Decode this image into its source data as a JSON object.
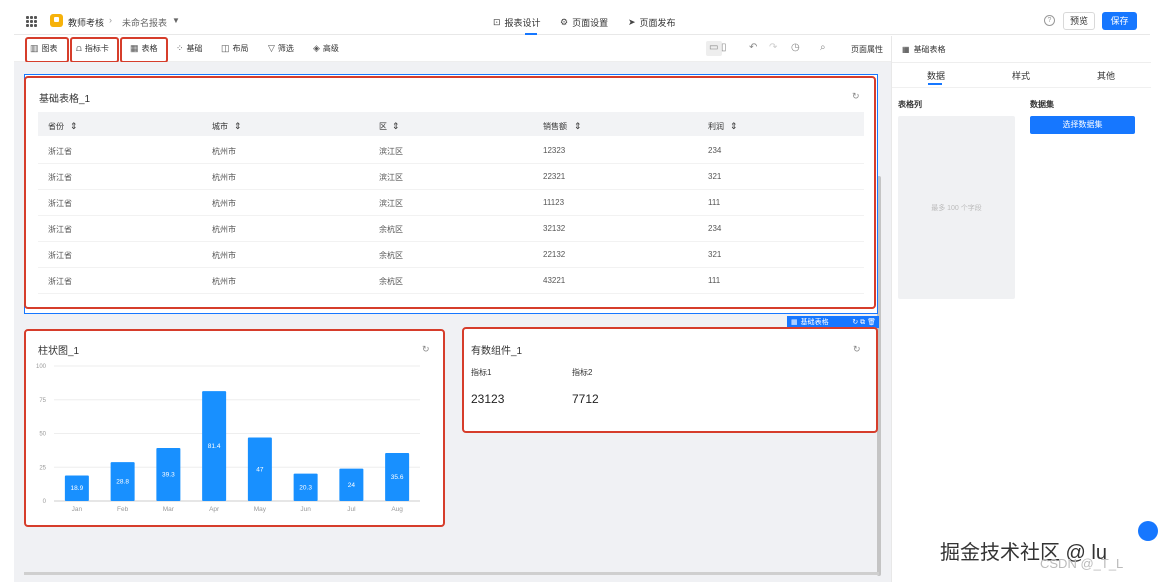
{
  "topbar": {
    "app_name": "教师考核",
    "report_name": "未命名报表",
    "nav": [
      {
        "icon": "report-design-icon",
        "label": "报表设计"
      },
      {
        "icon": "gear-icon",
        "label": "页面设置"
      },
      {
        "icon": "send-icon",
        "label": "页面发布"
      }
    ],
    "preview_label": "预览",
    "save_label": "保存"
  },
  "toolbar": {
    "tools": [
      {
        "icon": "bar-chart-icon",
        "label": "图表"
      },
      {
        "icon": "indicator-card-icon",
        "label": "指标卡"
      },
      {
        "icon": "table-icon",
        "label": "表格"
      },
      {
        "icon": "basic-icon",
        "label": "基础"
      },
      {
        "icon": "layout-icon",
        "label": "布局"
      },
      {
        "icon": "filter-icon",
        "label": "筛选"
      },
      {
        "icon": "advanced-icon",
        "label": "高级"
      }
    ],
    "page_props_label": "页面属性"
  },
  "right_panel": {
    "title": "基础表格",
    "tabs": [
      "数据",
      "样式",
      "其他"
    ],
    "active_tab": "数据",
    "columns_label": "表格列",
    "dataset_label": "数据集",
    "columns_hint": "最多 100 个字段",
    "select_dataset_label": "选择数据集"
  },
  "table_card": {
    "title": "基础表格_1",
    "headers": [
      "省份",
      "城市",
      "区",
      "销售额",
      "利润"
    ],
    "rows": [
      [
        "浙江省",
        "杭州市",
        "滨江区",
        "12323",
        "234"
      ],
      [
        "浙江省",
        "杭州市",
        "滨江区",
        "22321",
        "321"
      ],
      [
        "浙江省",
        "杭州市",
        "滨江区",
        "11123",
        "111"
      ],
      [
        "浙江省",
        "杭州市",
        "余杭区",
        "32132",
        "234"
      ],
      [
        "浙江省",
        "杭州市",
        "余杭区",
        "22132",
        "321"
      ],
      [
        "浙江省",
        "杭州市",
        "余杭区",
        "43221",
        "111"
      ]
    ],
    "selection_tag": "基础表格"
  },
  "bar_card": {
    "title": "柱状图_1"
  },
  "metric_card": {
    "title": "有数组件_1",
    "metrics": [
      {
        "label": "指标1",
        "value": "23123"
      },
      {
        "label": "指标2",
        "value": "7712"
      }
    ]
  },
  "chart_data": {
    "type": "bar",
    "categories": [
      "Jan",
      "Feb",
      "Mar",
      "Apr",
      "May",
      "Jun",
      "Jul",
      "Aug"
    ],
    "values": [
      18.9,
      28.8,
      39.3,
      81.4,
      47,
      20.3,
      24,
      35.6
    ],
    "yticks": [
      0,
      25,
      50,
      75,
      100
    ],
    "ylim": [
      0,
      100
    ],
    "grid": true,
    "bar_color": "#1890ff"
  },
  "watermark": {
    "line1": "掘金技术社区 @ lu",
    "line2": "CSDN @_T_L"
  },
  "colors": {
    "accent": "#1677ff",
    "highlight_frame": "#d63d2b"
  }
}
